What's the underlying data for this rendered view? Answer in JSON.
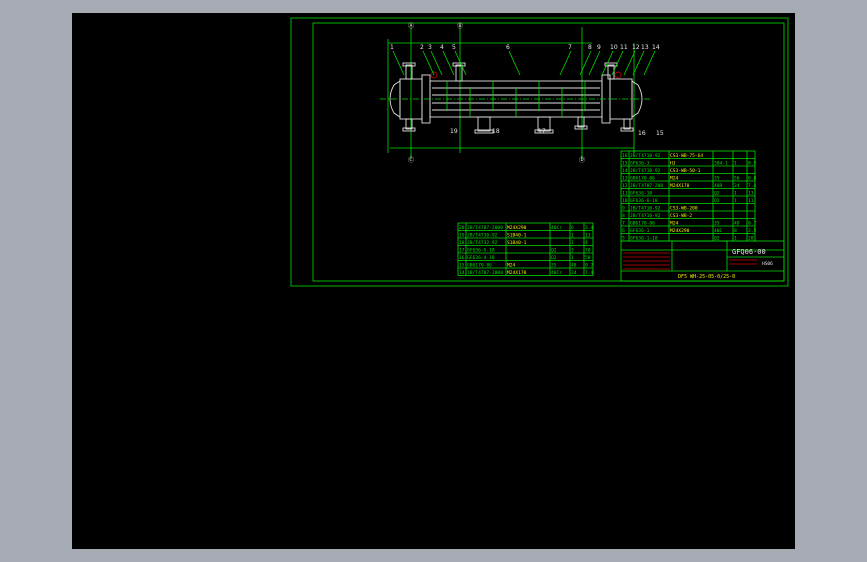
{
  "drawing": {
    "title_code": "GFQ06-00",
    "small_code": "HS06",
    "drawing_number": "DF5 WH-25-05-0/25-0",
    "callouts_top": [
      "1",
      "2",
      "3",
      "4",
      "5",
      "6",
      "7",
      "8",
      "9",
      "10",
      "11",
      "12",
      "13",
      "14"
    ],
    "callouts_bottom": [
      "19",
      "18",
      "17",
      "16",
      "15"
    ],
    "nozzle_marks": [
      "Ⓐ",
      "Ⓑ",
      "Ⓒ",
      "Ⓓ"
    ]
  },
  "bom_upper": [
    {
      "no": "16",
      "code": "JB/T4710-92",
      "name": "CS3-WB-75-64",
      "qty": "",
      "mat": "",
      "mass": ""
    },
    {
      "no": "15",
      "code": "GF636-3",
      "name": "HJ",
      "qty": "304-1",
      "mat": "1",
      "mass": "8.5"
    },
    {
      "no": "14",
      "code": "JB/T4710-92",
      "name": "CS3-WB-50-1",
      "qty": "",
      "mat": "",
      "mass": ""
    },
    {
      "no": "13",
      "code": "GB6170-86",
      "name": "M24",
      "qty": "35",
      "mat": "56",
      "mass": "0.8"
    },
    {
      "no": "12",
      "code": "JB/T4707-200",
      "name": "M24X170",
      "qty": "40R",
      "mat": "24",
      "mass": "7.4"
    },
    {
      "no": "11",
      "code": "GF636-18",
      "name": "",
      "qty": "Q2",
      "mat": "1",
      "mass": "13"
    },
    {
      "no": "10",
      "code": "GF636-6-18",
      "name": "",
      "qty": "Q2",
      "mat": "1",
      "mass": "11"
    },
    {
      "no": "9",
      "code": "JB/T4710-92",
      "name": "CS3-WB-200",
      "qty": "",
      "mat": "",
      "mass": ""
    },
    {
      "no": "8",
      "code": "JB/T4710-92",
      "name": "CS3-WB-2",
      "qty": "",
      "mat": "",
      "mass": ""
    },
    {
      "no": "7",
      "code": "GB6170-86",
      "name": "M24",
      "qty": "35",
      "mat": "48",
      "mass": "0.7"
    },
    {
      "no": "6",
      "code": "GF636-1",
      "name": "M24X290",
      "qty": "40C",
      "mat": "8",
      "mass": "2.5"
    },
    {
      "no": "5",
      "code": "GF636-1-18",
      "name": "",
      "qty": "Q2",
      "mat": "1",
      "mass": "20"
    }
  ],
  "bom_lower": [
    {
      "no": "20",
      "code": "JB/T4707-2000",
      "name": "M24X290",
      "qty": "40Cr",
      "mat": "6",
      "mass": "3.4"
    },
    {
      "no": "19",
      "code": "JB/T4710-92",
      "name": "S1B40-1",
      "qty": "",
      "mat": "1",
      "mass": "13"
    },
    {
      "no": "18",
      "code": "JB/T4732-92",
      "name": "S1B40-1",
      "qty": "",
      "mat": "1",
      "mass": "4"
    },
    {
      "no": "17",
      "code": "GF636-5-18",
      "name": "",
      "qty": "Q2",
      "mat": "3",
      "mass": "70"
    },
    {
      "no": "16",
      "code": "GF636-4-18",
      "name": "",
      "qty": "Q2",
      "mat": "1",
      "mass": "50"
    },
    {
      "no": "15",
      "code": "GB6170-86",
      "name": "M24",
      "qty": "35",
      "mat": "48",
      "mass": "0.7"
    },
    {
      "no": "14",
      "code": "JB/T4707-2000",
      "name": "M24X170",
      "qty": "40Cr",
      "mat": "24",
      "mass": "7.4"
    }
  ],
  "colors": {
    "canvas": "#000000",
    "frame": "#a6aab2",
    "line": "#00e000",
    "outline": "#e0e0e0",
    "mark": "#d00000",
    "highlight": "#f0f000"
  }
}
